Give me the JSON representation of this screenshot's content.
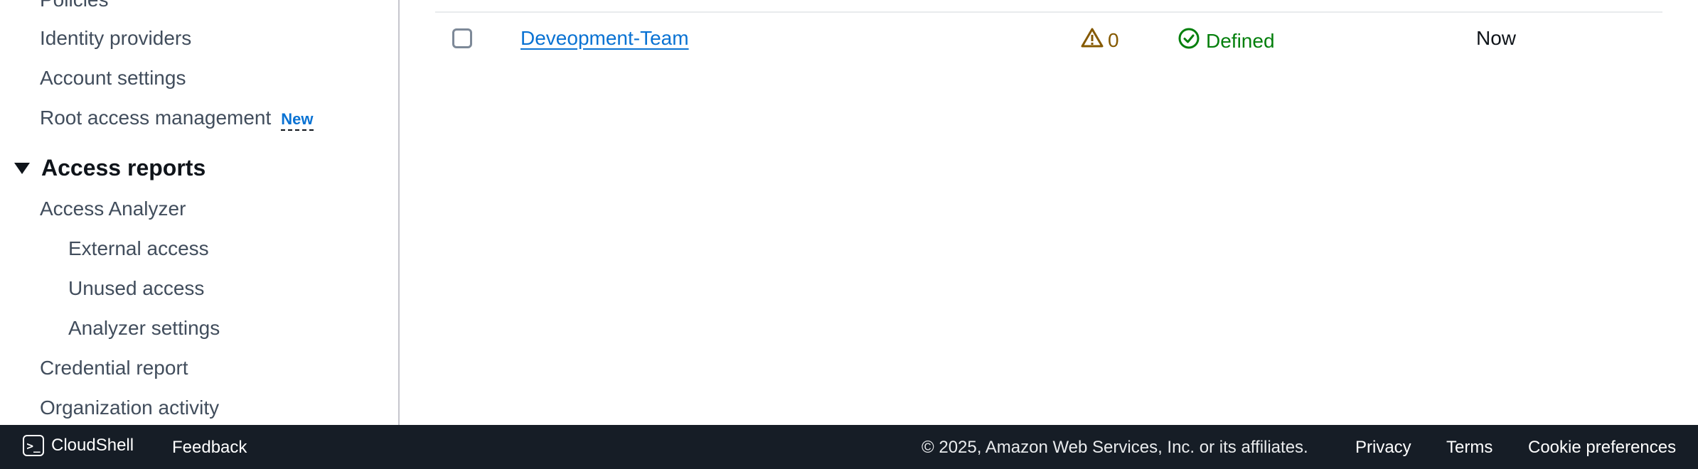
{
  "sidebar": {
    "partial_top_item": "Policies",
    "items_top": [
      {
        "label": "Identity providers"
      },
      {
        "label": "Account settings"
      },
      {
        "label": "Root access management",
        "badge": "New"
      }
    ],
    "section": {
      "title": "Access reports",
      "items": [
        {
          "label": "Access Analyzer",
          "level": 1
        },
        {
          "label": "External access",
          "level": 2
        },
        {
          "label": "Unused access",
          "level": 2
        },
        {
          "label": "Analyzer settings",
          "level": 2
        },
        {
          "label": "Credential report",
          "level": 1
        },
        {
          "label": "Organization activity",
          "level": 1
        }
      ]
    }
  },
  "table": {
    "rows": [
      {
        "selected": false,
        "name": "Deveopment-Team",
        "warnings": "0",
        "status": "Defined",
        "last": "Now"
      }
    ]
  },
  "colors": {
    "link": "#0972d3",
    "warning": "#855900",
    "success": "#037f0c",
    "footer_bg": "#161d26"
  },
  "footer": {
    "cloudshell_label": "CloudShell",
    "feedback_label": "Feedback",
    "copyright": "© 2025, Amazon Web Services, Inc. or its affiliates.",
    "privacy_label": "Privacy",
    "terms_label": "Terms",
    "cookie_label": "Cookie preferences"
  }
}
